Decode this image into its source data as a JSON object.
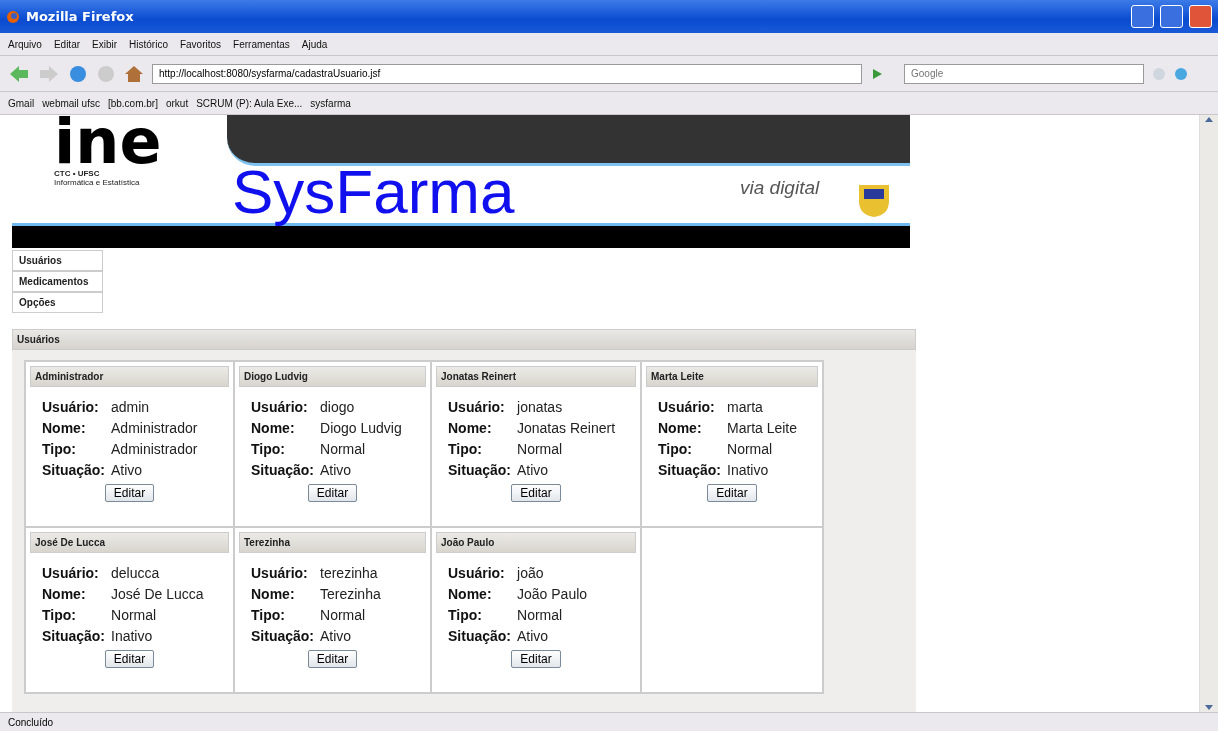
{
  "window": {
    "title": "Mozilla Firefox"
  },
  "menu": [
    "Arquivo",
    "Editar",
    "Exibir",
    "Histórico",
    "Favoritos",
    "Ferramentas",
    "Ajuda"
  ],
  "address": {
    "value": "http://localhost:8080/sysfarma/cadastraUsuario.jsf"
  },
  "search": {
    "placeholder": "Google"
  },
  "bookmarks": [
    "Gmail",
    "webmail ufsc",
    "[bb.com.br]",
    "orkut",
    "SCRUM (P): Aula Exe...",
    "sysfarma"
  ],
  "banner": {
    "logo": "ine",
    "logo_sub1": "CTC • UFSC",
    "logo_sub2": "Informática e Estatística",
    "title": "SysFarma",
    "partner": "via digital"
  },
  "side_menu": [
    "Usuários",
    "Medicamentos",
    "Opções"
  ],
  "panel": {
    "title": "Usuários",
    "users": [
      {
        "header": "Administrador",
        "fields": [
          {
            "label": "Usuário:",
            "value": "admin"
          },
          {
            "label": "Nome:",
            "value": "Administrador"
          },
          {
            "label": "Tipo:",
            "value": "Administrador"
          },
          {
            "label": "Situação:",
            "value": "Ativo"
          }
        ],
        "button": "Editar"
      },
      {
        "header": "Diogo Ludvig",
        "fields": [
          {
            "label": "Usuário:",
            "value": "diogo"
          },
          {
            "label": "Nome:",
            "value": "Diogo Ludvig"
          },
          {
            "label": "Tipo:",
            "value": "Normal"
          },
          {
            "label": "Situação:",
            "value": "Ativo"
          }
        ],
        "button": "Editar"
      },
      {
        "header": "Jonatas Reinert",
        "fields": [
          {
            "label": "Usuário:",
            "value": "jonatas"
          },
          {
            "label": "Nome:",
            "value": "Jonatas Reinert"
          },
          {
            "label": "Tipo:",
            "value": "Normal"
          },
          {
            "label": "Situação:",
            "value": "Ativo"
          }
        ],
        "button": "Editar"
      },
      {
        "header": "Marta Leite",
        "fields": [
          {
            "label": "Usuário:",
            "value": "marta"
          },
          {
            "label": "Nome:",
            "value": "Marta Leite"
          },
          {
            "label": "Tipo:",
            "value": "Normal"
          },
          {
            "label": "Situação:",
            "value": "Inativo"
          }
        ],
        "button": "Editar"
      },
      {
        "header": "José De Lucca",
        "fields": [
          {
            "label": "Usuário:",
            "value": "delucca"
          },
          {
            "label": "Nome:",
            "value": "José De Lucca"
          },
          {
            "label": "Tipo:",
            "value": "Normal"
          },
          {
            "label": "Situação:",
            "value": "Inativo"
          }
        ],
        "button": "Editar"
      },
      {
        "header": "Terezinha",
        "fields": [
          {
            "label": "Usuário:",
            "value": "terezinha"
          },
          {
            "label": "Nome:",
            "value": "Terezinha"
          },
          {
            "label": "Tipo:",
            "value": "Normal"
          },
          {
            "label": "Situação:",
            "value": "Ativo"
          }
        ],
        "button": "Editar"
      },
      {
        "header": "João Paulo",
        "fields": [
          {
            "label": "Usuário:",
            "value": "joão"
          },
          {
            "label": "Nome:",
            "value": "João Paulo"
          },
          {
            "label": "Tipo:",
            "value": "Normal"
          },
          {
            "label": "Situação:",
            "value": "Ativo"
          }
        ],
        "button": "Editar"
      }
    ]
  },
  "status_bar": "Concluído"
}
